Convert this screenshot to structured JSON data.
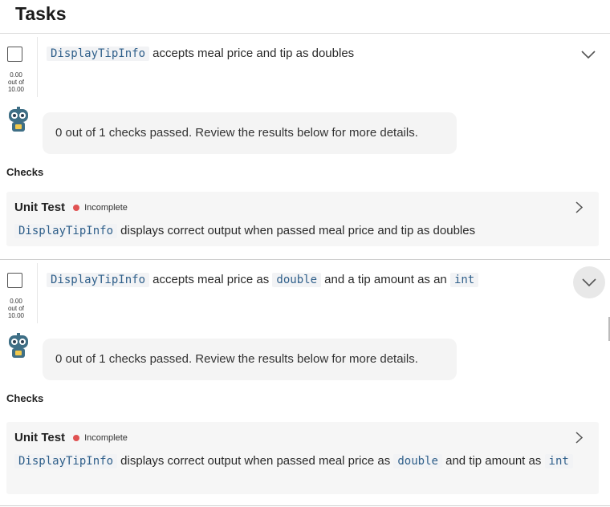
{
  "header": {
    "title": "Tasks"
  },
  "tasks": [
    {
      "score": {
        "value": "0.00",
        "out_of": "out of",
        "max": "10.00"
      },
      "title": {
        "code1": "DisplayTipInfo",
        "text1": " accepts meal price and tip as doubles"
      },
      "bot_message": "0 out of 1 checks passed. Review the results below for more details.",
      "checks_label": "Checks",
      "check": {
        "name": "Unit Test",
        "status": "Incomplete",
        "code1": "DisplayTipInfo",
        "text1": " displays correct output when passed meal price and tip as doubles"
      }
    },
    {
      "score": {
        "value": "0.00",
        "out_of": "out of",
        "max": "10.00"
      },
      "title": {
        "code1": "DisplayTipInfo",
        "text1": " accepts meal price as ",
        "code2": "double",
        "text2": " and a tip amount as an ",
        "code3": "int"
      },
      "bot_message": "0 out of 1 checks passed. Review the results below for more details.",
      "checks_label": "Checks",
      "check": {
        "name": "Unit Test",
        "status": "Incomplete",
        "code1": "DisplayTipInfo",
        "text1": " displays correct output when passed meal price as ",
        "code2": "double",
        "text2": " and tip amount as ",
        "code3": "int"
      }
    }
  ],
  "colors": {
    "status_incomplete": "#e05252",
    "code_text": "#2f5f8a",
    "bubble_bg": "#f4f4f4"
  },
  "icons": [
    "checkbox",
    "chevron-down-icon",
    "robot-avatar-icon",
    "chevron-right-icon"
  ]
}
